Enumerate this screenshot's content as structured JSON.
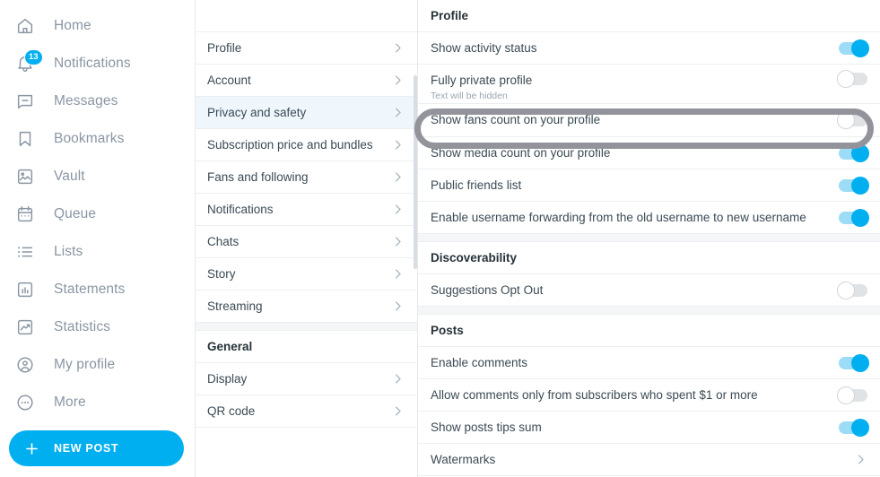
{
  "colors": {
    "accent": "#00aff0",
    "toggle_on_track": "#9cdcf7",
    "toggle_off_track": "#dfe3e6",
    "selected_row_bg": "#eff7fd",
    "highlight_ring": "#93939b",
    "text_primary": "#3b4a54",
    "text_muted": "#8a96a3"
  },
  "sidebar": {
    "items": [
      {
        "label": "Home",
        "icon": "home-icon"
      },
      {
        "label": "Notifications",
        "icon": "bell-icon",
        "badge": "13"
      },
      {
        "label": "Messages",
        "icon": "message-icon"
      },
      {
        "label": "Bookmarks",
        "icon": "bookmark-icon"
      },
      {
        "label": "Vault",
        "icon": "vault-image-icon"
      },
      {
        "label": "Queue",
        "icon": "calendar-icon"
      },
      {
        "label": "Lists",
        "icon": "list-icon"
      },
      {
        "label": "Statements",
        "icon": "bar-chart-icon"
      },
      {
        "label": "Statistics",
        "icon": "trend-chart-icon"
      },
      {
        "label": "My profile",
        "icon": "user-circle-icon"
      },
      {
        "label": "More",
        "icon": "ellipsis-circle-icon"
      }
    ],
    "new_post_button": {
      "label": "NEW POST",
      "icon": "plus-icon"
    }
  },
  "menu": {
    "rows": [
      {
        "type": "spacer"
      },
      {
        "type": "item",
        "label": "Profile",
        "selected": false
      },
      {
        "type": "item",
        "label": "Account",
        "selected": false
      },
      {
        "type": "item",
        "label": "Privacy and safety",
        "selected": true
      },
      {
        "type": "item",
        "label": "Subscription price and bundles",
        "selected": false
      },
      {
        "type": "item",
        "label": "Fans and following",
        "selected": false
      },
      {
        "type": "item",
        "label": "Notifications",
        "selected": false
      },
      {
        "type": "item",
        "label": "Chats",
        "selected": false
      },
      {
        "type": "item",
        "label": "Story",
        "selected": false
      },
      {
        "type": "item",
        "label": "Streaming",
        "selected": false
      },
      {
        "type": "gap"
      },
      {
        "type": "header",
        "label": "General"
      },
      {
        "type": "item",
        "label": "Display",
        "selected": false
      },
      {
        "type": "item",
        "label": "QR code",
        "selected": false
      }
    ]
  },
  "content": {
    "rows": [
      {
        "type": "header",
        "label": "Profile"
      },
      {
        "type": "toggle",
        "label": "Show activity status",
        "state": "on"
      },
      {
        "type": "toggle",
        "label": "Fully private profile",
        "sub": "Text will be hidden",
        "state": "off"
      },
      {
        "type": "toggle",
        "label": "Show fans count on your profile",
        "state": "off",
        "highlighted": true
      },
      {
        "type": "toggle",
        "label": "Show media count on your profile",
        "state": "on"
      },
      {
        "type": "toggle",
        "label": "Public friends list",
        "state": "on"
      },
      {
        "type": "toggle",
        "label": "Enable username forwarding from the old username to new username",
        "state": "on"
      },
      {
        "type": "gap"
      },
      {
        "type": "header",
        "label": "Discoverability"
      },
      {
        "type": "toggle",
        "label": "Suggestions Opt Out",
        "state": "off"
      },
      {
        "type": "gap"
      },
      {
        "type": "header",
        "label": "Posts"
      },
      {
        "type": "toggle",
        "label": "Enable comments",
        "state": "on"
      },
      {
        "type": "toggle",
        "label": "Allow comments only from subscribers who spent $1 or more",
        "state": "off"
      },
      {
        "type": "toggle",
        "label": "Show posts tips sum",
        "state": "on"
      },
      {
        "type": "link",
        "label": "Watermarks"
      }
    ]
  }
}
